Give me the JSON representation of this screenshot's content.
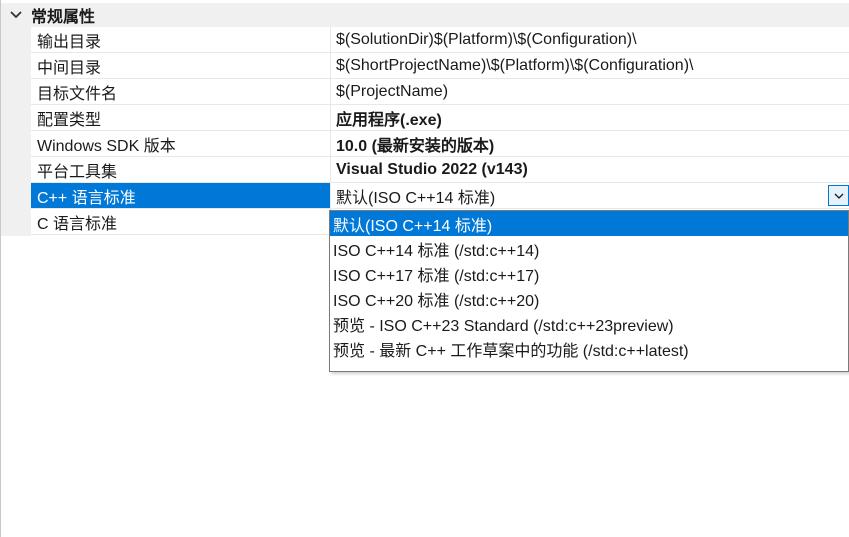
{
  "category": {
    "title": "常规属性"
  },
  "rows": [
    {
      "name": "输出目录",
      "value": "$(SolutionDir)$(Platform)\\$(Configuration)\\"
    },
    {
      "name": "中间目录",
      "value": "$(ShortProjectName)\\$(Platform)\\$(Configuration)\\"
    },
    {
      "name": "目标文件名",
      "value": "$(ProjectName)"
    },
    {
      "name": "配置类型",
      "value": "应用程序(.exe)"
    },
    {
      "name": "Windows SDK 版本",
      "value": "10.0 (最新安装的版本)"
    },
    {
      "name": "平台工具集",
      "value": "Visual Studio 2022 (v143)"
    },
    {
      "name": "C++ 语言标准",
      "value": "默认(ISO C++14 标准)"
    },
    {
      "name": "C 语言标准",
      "value": ""
    }
  ],
  "dropdown": {
    "options": [
      "默认(ISO C++14 标准)",
      "ISO C++14 标准 (/std:c++14)",
      "ISO C++17 标准 (/std:c++17)",
      "ISO C++20 标准 (/std:c++20)",
      "预览 - ISO C++23 Standard (/std:c++23preview)",
      "预览 - 最新 C++ 工作草案中的功能 (/std:c++latest)"
    ],
    "selected_index": 0
  },
  "colors": {
    "selection": "#0078d7",
    "category_bg": "#f0f0f0"
  },
  "icons": {
    "category_toggle": "chevron-down-icon",
    "combo_arrow": "chevron-down-icon"
  }
}
